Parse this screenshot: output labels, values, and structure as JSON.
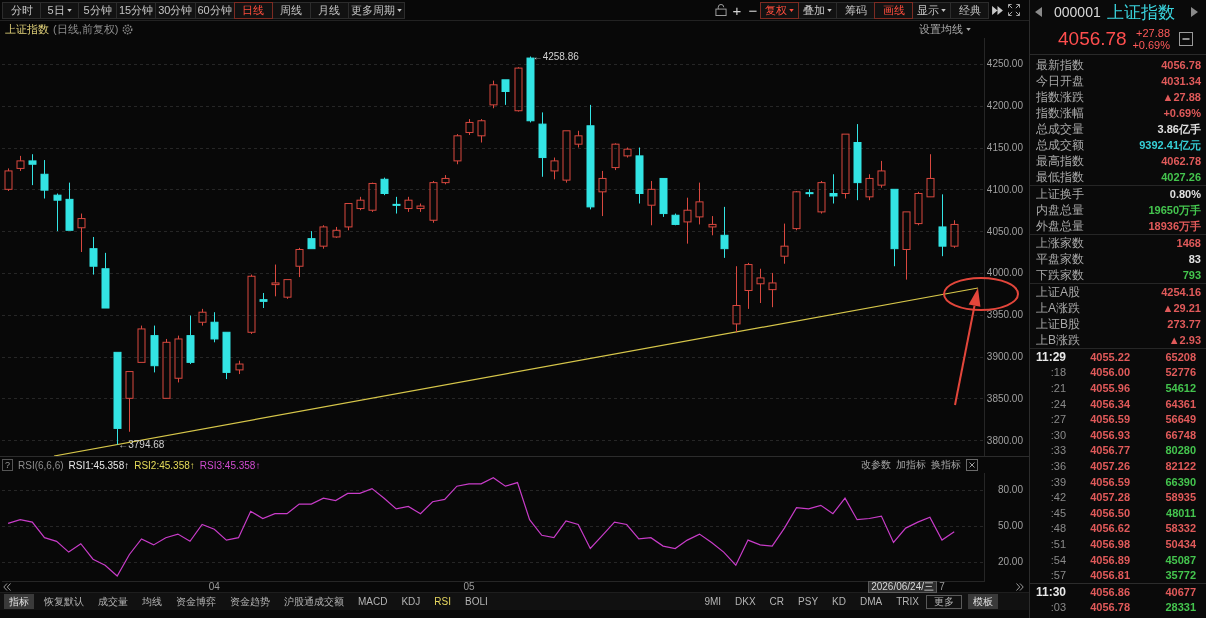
{
  "toolbar": {
    "periods": [
      {
        "label": "分时",
        "selected": false,
        "dropdown": false
      },
      {
        "label": "5日",
        "selected": false,
        "dropdown": true
      },
      {
        "label": "5分钟",
        "selected": false,
        "dropdown": false
      },
      {
        "label": "15分钟",
        "selected": false,
        "dropdown": false
      },
      {
        "label": "30分钟",
        "selected": false,
        "dropdown": false
      },
      {
        "label": "60分钟",
        "selected": false,
        "dropdown": false
      },
      {
        "label": "日线",
        "selected": true,
        "dropdown": false
      },
      {
        "label": "周线",
        "selected": false,
        "dropdown": false
      },
      {
        "label": "月线",
        "selected": false,
        "dropdown": false
      },
      {
        "label": "更多周期",
        "selected": false,
        "dropdown": true
      }
    ],
    "zoom_buttons": [
      "+",
      "−"
    ],
    "tools": [
      {
        "label": "复权",
        "active": true,
        "dropdown": true
      },
      {
        "label": "叠加",
        "active": false,
        "dropdown": true
      },
      {
        "label": "筹码",
        "active": false,
        "dropdown": false
      },
      {
        "label": "画线",
        "active": true,
        "dropdown": false
      },
      {
        "label": "显示",
        "active": false,
        "dropdown": true
      },
      {
        "label": "经典",
        "active": false,
        "dropdown": false
      }
    ]
  },
  "main_chart": {
    "title": "上证指数",
    "subtitle": "(日线,前复权)",
    "ma_settings": "设置均线",
    "chart_data": {
      "type": "candlestick",
      "grid": true,
      "categories": [
        null,
        null,
        null,
        null,
        null,
        null,
        null,
        null,
        null,
        null,
        null,
        null,
        null,
        null,
        null,
        null,
        null,
        null,
        null,
        null,
        null,
        null,
        null,
        null,
        null,
        null,
        null,
        null,
        null,
        null,
        null,
        null,
        null,
        null,
        null,
        null,
        null,
        null,
        null,
        null,
        null,
        null,
        null,
        null,
        null,
        null,
        null,
        null,
        null,
        null,
        null,
        null,
        null,
        null,
        null,
        null,
        null,
        null,
        null,
        null,
        null,
        null,
        null,
        null,
        null,
        null,
        null,
        null,
        null,
        null,
        null,
        null,
        null,
        null,
        null,
        null,
        null,
        null,
        null,
        null,
        null
      ],
      "ohlc": [
        [
          4100,
          4125,
          4098,
          4122
        ],
        [
          4125,
          4140,
          4122,
          4134
        ],
        [
          4134,
          4142,
          4105,
          4130
        ],
        [
          4118,
          4135,
          4089,
          4099
        ],
        [
          4093,
          4095,
          4050,
          4087
        ],
        [
          4088,
          4108,
          4051,
          4051
        ],
        [
          4054,
          4071,
          4025,
          4065
        ],
        [
          4029,
          4043,
          3998,
          4008
        ],
        [
          4005,
          4024,
          3958,
          3958
        ],
        [
          3905,
          3905,
          3794.68,
          3814
        ],
        [
          3850,
          3882,
          3810,
          3882
        ],
        [
          3893,
          3937,
          3893,
          3933
        ],
        [
          3925,
          3937,
          3881,
          3889
        ],
        [
          3850,
          3921,
          3850,
          3917
        ],
        [
          3874,
          3925,
          3869,
          3921
        ],
        [
          3925,
          3949,
          3891,
          3893
        ],
        [
          3941,
          3957,
          3937,
          3953
        ],
        [
          3941,
          3953,
          3917,
          3921
        ],
        [
          3929,
          3929,
          3873,
          3881
        ],
        [
          3884,
          3895,
          3879,
          3891
        ],
        [
          3929,
          3998,
          3927,
          3996
        ],
        [
          3968,
          3976,
          3958,
          3966
        ],
        [
          3986,
          4010,
          3972,
          3988
        ],
        [
          3971,
          3992,
          3969,
          3992
        ],
        [
          4008,
          4030,
          3995,
          4028
        ],
        [
          4041,
          4050,
          4029,
          4029
        ],
        [
          4032,
          4057,
          4029,
          4055
        ],
        [
          4043,
          4055,
          4042,
          4051
        ],
        [
          4055,
          4083,
          4051,
          4083
        ],
        [
          4077,
          4091,
          4075,
          4087
        ],
        [
          4075,
          4108,
          4073,
          4107
        ],
        [
          4112,
          4114,
          4093,
          4095
        ],
        [
          4082,
          4091,
          4071,
          4081
        ],
        [
          4077,
          4091,
          4073,
          4087
        ],
        [
          4077,
          4083,
          4073,
          4080
        ],
        [
          4063,
          4110,
          4060,
          4108
        ],
        [
          4108,
          4117,
          4106,
          4113
        ],
        [
          4134,
          4166,
          4130,
          4164
        ],
        [
          4168,
          4184,
          4165,
          4180
        ],
        [
          4164,
          4184,
          4156,
          4182
        ],
        [
          4201,
          4230,
          4197,
          4225
        ],
        [
          4231,
          4231,
          4201,
          4217
        ],
        [
          4194,
          4246,
          4193,
          4245
        ],
        [
          4257,
          4258.86,
          4180,
          4182
        ],
        [
          4178,
          4192,
          4115,
          4138
        ],
        [
          4122,
          4138,
          4112,
          4134
        ],
        [
          4111,
          4170,
          4108,
          4170
        ],
        [
          4154,
          4170,
          4150,
          4164
        ],
        [
          4176,
          4201,
          4076,
          4079
        ],
        [
          4097,
          4122,
          4068,
          4113
        ],
        [
          4126,
          4155,
          4123,
          4154
        ],
        [
          4140,
          4150,
          4138,
          4148
        ],
        [
          4140,
          4150,
          4083,
          4095
        ],
        [
          4081,
          4110,
          4057,
          4100
        ],
        [
          4113,
          4113,
          4067,
          4071
        ],
        [
          4069,
          4071,
          4057,
          4058
        ],
        [
          4061,
          4090,
          4035,
          4075
        ],
        [
          4067,
          4108,
          4058,
          4085
        ],
        [
          4055,
          4068,
          4045,
          4058
        ],
        [
          4045,
          4079,
          4018,
          4029
        ],
        [
          3939,
          4008,
          3929,
          3961
        ],
        [
          3979,
          4012,
          3957,
          4010
        ],
        [
          3987,
          4005,
          3964,
          3994
        ],
        [
          3980,
          4000,
          3959,
          3988
        ],
        [
          4020,
          4059,
          4011,
          4032
        ],
        [
          4053,
          4098,
          4051,
          4097
        ],
        [
          4096,
          4100,
          4091,
          4095
        ],
        [
          4073,
          4110,
          4071,
          4108
        ],
        [
          4095,
          4118,
          4083,
          4092
        ],
        [
          4095,
          4166,
          4089,
          4166
        ],
        [
          4156,
          4178,
          4087,
          4108
        ],
        [
          4091,
          4118,
          4087,
          4113
        ],
        [
          4105,
          4134,
          4102,
          4122
        ],
        [
          4100,
          4100,
          4008,
          4029
        ],
        [
          4028,
          4073,
          3992,
          4073
        ],
        [
          4059,
          4097,
          4057,
          4095
        ],
        [
          4091,
          4142,
          4091,
          4113
        ],
        [
          4055,
          4094,
          4020,
          4032
        ],
        [
          4032,
          4063,
          4030,
          4058
        ],
        null,
        null
      ],
      "ylim": [
        3781,
        4281
      ],
      "yticks": [
        {
          "value": 4250,
          "label": "4250.00"
        },
        {
          "value": 4200,
          "label": "4200.00"
        },
        {
          "value": 4150,
          "label": "4150.00"
        },
        {
          "value": 4100,
          "label": "4100.00"
        },
        {
          "value": 4050,
          "label": "4050.00"
        },
        {
          "value": 4000,
          "label": "4000.00"
        },
        {
          "value": 3950,
          "label": "3950.00"
        },
        {
          "value": 3900,
          "label": "3900.00"
        },
        {
          "value": 3850,
          "label": "3850.00"
        },
        {
          "value": 3800,
          "label": "3800.00"
        }
      ]
    },
    "high_label": "←4258.86",
    "low_label": "←3794.68"
  },
  "rsi_panel": {
    "help": "?",
    "name": "RSI(6,6,6)",
    "legend": [
      {
        "label": "RSI1:45.358↑",
        "color": "#e8e8e8"
      },
      {
        "label": "RSI2:45.358↑",
        "color": "#e6dc5a"
      },
      {
        "label": "RSI3:45.358↑",
        "color": "#d04cd0"
      }
    ],
    "actions": [
      "改参数",
      "加指标",
      "换指标"
    ],
    "chart_data": {
      "type": "line",
      "grid": true,
      "categories": [
        null,
        null,
        null,
        null,
        null,
        null,
        null,
        null,
        null,
        null,
        null,
        null,
        null,
        null,
        null,
        null,
        null,
        "04",
        null,
        null,
        null,
        null,
        null,
        null,
        null,
        null,
        null,
        null,
        null,
        null,
        null,
        null,
        null,
        null,
        null,
        null,
        null,
        null,
        "05",
        null,
        null,
        null,
        null,
        null,
        null,
        null,
        null,
        null,
        null,
        null,
        null,
        null,
        null,
        null,
        null,
        null,
        null,
        null,
        null,
        null,
        null,
        null,
        null,
        null,
        null,
        null,
        null,
        null,
        null,
        null,
        null,
        null,
        null,
        null,
        null,
        null,
        null,
        "7",
        null,
        null,
        null
      ],
      "ylim": [
        3,
        94
      ],
      "yticks": [
        {
          "value": 80,
          "label": "80.00"
        },
        {
          "value": 50,
          "label": "50.00"
        },
        {
          "value": 20,
          "label": "20.00"
        }
      ],
      "series": [
        {
          "color": "#c83cc8",
          "values": [
            52,
            55,
            53,
            40,
            37,
            28,
            35,
            22,
            17,
            8,
            26,
            39,
            34,
            40,
            43,
            37,
            51,
            47,
            38,
            40,
            62,
            56,
            60,
            60,
            68,
            68,
            73,
            71,
            77,
            77,
            81,
            73,
            64,
            66,
            60,
            70,
            72,
            83,
            85,
            85,
            90,
            83,
            86,
            55,
            42,
            40,
            54,
            51,
            31,
            42,
            53,
            51,
            39,
            40,
            33,
            31,
            38,
            43,
            36,
            28,
            17,
            38,
            34,
            33,
            48,
            65,
            64,
            67,
            60,
            73,
            55,
            56,
            58,
            36,
            48,
            53,
            57,
            38,
            45,
            null,
            null
          ]
        }
      ]
    },
    "cursor_date": "2026/06/24/三"
  },
  "indicator_bar": {
    "tabs": [
      {
        "label": "指标",
        "kind": "button",
        "selected": false
      },
      {
        "label": "恢复默认",
        "kind": "tab",
        "selected": false
      },
      {
        "label": "成交量",
        "kind": "tab",
        "selected": false
      },
      {
        "label": "均线",
        "kind": "tab",
        "selected": false
      },
      {
        "label": "资金博弈",
        "kind": "tab",
        "selected": false
      },
      {
        "label": "资金趋势",
        "kind": "tab",
        "selected": false
      },
      {
        "label": "沪股通成交额",
        "kind": "tab",
        "selected": false
      },
      {
        "label": "MACD",
        "kind": "tab",
        "selected": false
      },
      {
        "label": "KDJ",
        "kind": "tab",
        "selected": false
      },
      {
        "label": "RSI",
        "kind": "tab",
        "selected": true
      },
      {
        "label": "BOLI",
        "kind": "tab",
        "selected": false
      }
    ],
    "trailing": [
      {
        "label": "9MI",
        "kind": "tab",
        "selected": false
      },
      {
        "label": "DKX",
        "kind": "tab",
        "selected": false
      },
      {
        "label": "CR",
        "kind": "tab",
        "selected": false
      },
      {
        "label": "PSY",
        "kind": "tab",
        "selected": false
      },
      {
        "label": "KD",
        "kind": "tab",
        "selected": false
      },
      {
        "label": "DMA",
        "kind": "tab",
        "selected": false
      },
      {
        "label": "TRIX",
        "kind": "tab",
        "selected": false
      },
      {
        "label": "更多",
        "kind": "menu",
        "selected": false
      },
      {
        "label": "模板",
        "kind": "button",
        "selected": false
      }
    ]
  },
  "quote": {
    "code": "000001",
    "name": "上证指数",
    "price": "4056.78",
    "change": "+27.88",
    "change_pct": "+0.69%"
  },
  "stat_groups": [
    {
      "items": [
        {
          "label": "最新指数",
          "value": "4056.78",
          "color": "#e05a5a"
        },
        {
          "label": "今日开盘",
          "value": "4031.34",
          "color": "#e05a5a"
        },
        {
          "label": "指数涨跌",
          "value": "▲27.88",
          "color": "#e05a5a"
        },
        {
          "label": "指数涨幅",
          "value": "+0.69%",
          "color": "#e05a5a"
        },
        {
          "label": "总成交量",
          "value": "3.86亿手",
          "color": "#e0e0e0"
        },
        {
          "label": "总成交额",
          "value": "9392.41亿元",
          "color": "#36cfd6"
        },
        {
          "label": "最高指数",
          "value": "4062.78",
          "color": "#e05a5a"
        },
        {
          "label": "最低指数",
          "value": "4027.26",
          "color": "#44c44e"
        }
      ]
    },
    {
      "items": [
        {
          "label": "上证换手",
          "value": "0.80%",
          "color": "#e0e0e0"
        },
        {
          "label": "内盘总量",
          "value": "19650万手",
          "color": "#44c44e"
        },
        {
          "label": "外盘总量",
          "value": "18936万手",
          "color": "#e05a5a"
        }
      ]
    },
    {
      "items": [
        {
          "label": "上涨家数",
          "value": "1468",
          "color": "#e05a5a"
        },
        {
          "label": "平盘家数",
          "value": "83",
          "color": "#e0e0e0"
        },
        {
          "label": "下跌家数",
          "value": "793",
          "color": "#44c44e"
        }
      ]
    },
    {
      "items": [
        {
          "label": "上证A股",
          "value": "4254.16",
          "color": "#e05a5a"
        },
        {
          "label": "上A涨跌",
          "value": "▲29.21",
          "color": "#e05a5a"
        },
        {
          "label": "上证B股",
          "value": "273.77",
          "color": "#e05a5a"
        },
        {
          "label": "上B涨跌",
          "value": "▲2.93",
          "color": "#e05a5a"
        }
      ]
    }
  ],
  "ticks": [
    {
      "time": "11:29",
      "kind": "minute",
      "price": {
        "text": "4055.22",
        "color": "#e05a5a"
      },
      "volume": {
        "text": "65208",
        "color": "#e05a5a"
      }
    },
    {
      "time": ":18",
      "kind": "second",
      "price": {
        "text": "4056.00",
        "color": "#e05a5a"
      },
      "volume": {
        "text": "52776",
        "color": "#e05a5a"
      }
    },
    {
      "time": ":21",
      "kind": "second",
      "price": {
        "text": "4055.96",
        "color": "#e05a5a"
      },
      "volume": {
        "text": "54612",
        "color": "#44c44e"
      }
    },
    {
      "time": ":24",
      "kind": "second",
      "price": {
        "text": "4056.34",
        "color": "#e05a5a"
      },
      "volume": {
        "text": "64361",
        "color": "#e05a5a"
      }
    },
    {
      "time": ":27",
      "kind": "second",
      "price": {
        "text": "4056.59",
        "color": "#e05a5a"
      },
      "volume": {
        "text": "56649",
        "color": "#e05a5a"
      }
    },
    {
      "time": ":30",
      "kind": "second",
      "price": {
        "text": "4056.93",
        "color": "#e05a5a"
      },
      "volume": {
        "text": "66748",
        "color": "#e05a5a"
      }
    },
    {
      "time": ":33",
      "kind": "second",
      "price": {
        "text": "4056.77",
        "color": "#e05a5a"
      },
      "volume": {
        "text": "80280",
        "color": "#44c44e"
      }
    },
    {
      "time": ":36",
      "kind": "second",
      "price": {
        "text": "4057.26",
        "color": "#e05a5a"
      },
      "volume": {
        "text": "82122",
        "color": "#e05a5a"
      }
    },
    {
      "time": ":39",
      "kind": "second",
      "price": {
        "text": "4056.59",
        "color": "#e05a5a"
      },
      "volume": {
        "text": "66390",
        "color": "#44c44e"
      }
    },
    {
      "time": ":42",
      "kind": "second",
      "price": {
        "text": "4057.28",
        "color": "#e05a5a"
      },
      "volume": {
        "text": "58935",
        "color": "#e05a5a"
      }
    },
    {
      "time": ":45",
      "kind": "second",
      "price": {
        "text": "4056.50",
        "color": "#e05a5a"
      },
      "volume": {
        "text": "48011",
        "color": "#44c44e"
      }
    },
    {
      "time": ":48",
      "kind": "second",
      "price": {
        "text": "4056.62",
        "color": "#e05a5a"
      },
      "volume": {
        "text": "58332",
        "color": "#e05a5a"
      }
    },
    {
      "time": ":51",
      "kind": "second",
      "price": {
        "text": "4056.98",
        "color": "#e05a5a"
      },
      "volume": {
        "text": "50434",
        "color": "#e05a5a"
      }
    },
    {
      "time": ":54",
      "kind": "second",
      "price": {
        "text": "4056.89",
        "color": "#e05a5a"
      },
      "volume": {
        "text": "45087",
        "color": "#44c44e"
      }
    },
    {
      "time": ":57",
      "kind": "second",
      "price": {
        "text": "4056.81",
        "color": "#e05a5a"
      },
      "volume": {
        "text": "35772",
        "color": "#44c44e"
      }
    },
    {
      "time": "11:30",
      "kind": "minute",
      "price": {
        "text": "4056.86",
        "color": "#e05a5a"
      },
      "volume": {
        "text": "40677",
        "color": "#e05a5a"
      }
    },
    {
      "time": ":03",
      "kind": "second",
      "price": {
        "text": "4056.78",
        "color": "#e05a5a"
      },
      "volume": {
        "text": "28331",
        "color": "#44c44e"
      }
    }
  ]
}
